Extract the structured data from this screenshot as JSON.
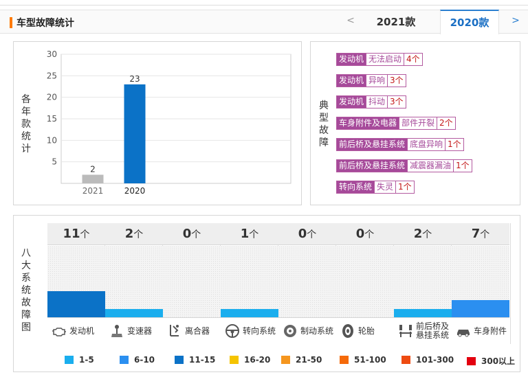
{
  "header": {
    "title": "车型故障统计",
    "prev": "<",
    "next": ">",
    "tabs": [
      {
        "label": "2021款",
        "active": false
      },
      {
        "label": "2020款",
        "active": true
      }
    ]
  },
  "years_panel": {
    "side_label": [
      "各",
      "年",
      "款",
      "统",
      "计"
    ],
    "chart_data": {
      "type": "bar",
      "categories": [
        "2021",
        "2020"
      ],
      "values": [
        2,
        23
      ],
      "value_labels": [
        "2",
        "23"
      ],
      "yticks": [
        "5",
        "10",
        "15",
        "20",
        "25",
        "30"
      ],
      "ylim": [
        0,
        30
      ],
      "colors": [
        "#bbbbbb",
        "#0b72c7"
      ]
    }
  },
  "faults_panel": {
    "side_label": [
      "典",
      "型",
      "故",
      "障"
    ],
    "items": [
      {
        "system": "发动机",
        "issue": "无法启动",
        "count": "4个"
      },
      {
        "system": "发动机",
        "issue": "异响",
        "count": "3个"
      },
      {
        "system": "发动机",
        "issue": "抖动",
        "count": "3个"
      },
      {
        "system": "车身附件及电器",
        "issue": "部件开裂",
        "count": "2个"
      },
      {
        "system": "前后桥及悬挂系统",
        "issue": "底盘异响",
        "count": "1个"
      },
      {
        "system": "前后桥及悬挂系统",
        "issue": "减震器漏油",
        "count": "1个"
      },
      {
        "system": "转向系统",
        "issue": "失灵",
        "count": "1个"
      }
    ]
  },
  "systems_panel": {
    "side_label": [
      "八",
      "大",
      "系",
      "统",
      "故",
      "障",
      "图"
    ],
    "unit": "个",
    "systems": [
      {
        "count": "11",
        "name": "发动机",
        "name2": "",
        "icon": "engine-icon",
        "color": "#0b72c7",
        "level": 0.37
      },
      {
        "count": "2",
        "name": "变速器",
        "name2": "",
        "icon": "gearbox-icon",
        "color": "#1aaeee",
        "level": 0.12
      },
      {
        "count": "0",
        "name": "离合器",
        "name2": "",
        "icon": "clutch-icon",
        "color": "#1aaeee",
        "level": 0
      },
      {
        "count": "1",
        "name": "转向系统",
        "name2": "",
        "icon": "steering-wheel-icon",
        "color": "#1aaeee",
        "level": 0.12
      },
      {
        "count": "0",
        "name": "制动系统",
        "name2": "",
        "icon": "brake-disc-icon",
        "color": "#1aaeee",
        "level": 0
      },
      {
        "count": "0",
        "name": "轮胎",
        "name2": "",
        "icon": "tire-icon",
        "color": "#1aaeee",
        "level": 0
      },
      {
        "count": "2",
        "name": "前后桥及",
        "name2": "悬挂系统",
        "icon": "suspension-icon",
        "color": "#1aaeee",
        "level": 0.12
      },
      {
        "count": "7",
        "name": "车身附件",
        "name2": "",
        "icon": "car-body-icon",
        "color": "#2b8ff0",
        "level": 0.24
      }
    ],
    "legend": [
      {
        "label": "1-5",
        "color": "#1aaeee"
      },
      {
        "label": "6-10",
        "color": "#2b8ff0"
      },
      {
        "label": "11-15",
        "color": "#0b72c7"
      },
      {
        "label": "16-20",
        "color": "#f5c400"
      },
      {
        "label": "21-50",
        "color": "#f5961e"
      },
      {
        "label": "51-100",
        "color": "#f56a0a"
      },
      {
        "label": "101-300",
        "color": "#ee4b12"
      },
      {
        "label": "300以上",
        "color": "#e3000f"
      }
    ]
  }
}
